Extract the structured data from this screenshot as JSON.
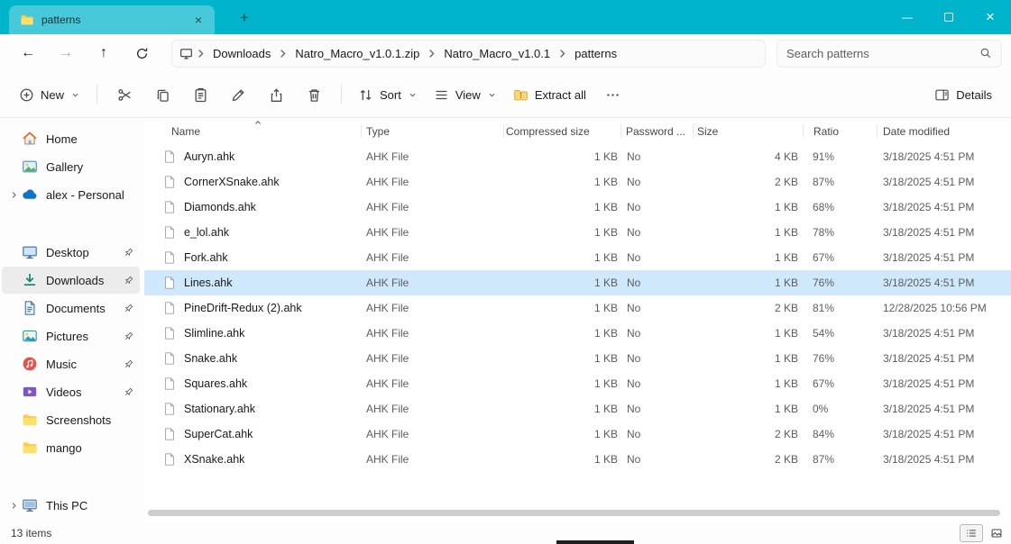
{
  "window": {
    "tab_title": "patterns"
  },
  "glyphs": {
    "back": "←",
    "forward": "→",
    "up": "↑",
    "minimize": "—",
    "close": "×",
    "new_tab": "+",
    "tab_close": "×"
  },
  "navigation": {
    "breadcrumb": [
      "Downloads",
      "Natro_Macro_v1.0.1.zip",
      "Natro_Macro_v1.0.1",
      "patterns"
    ],
    "search_placeholder": "Search patterns"
  },
  "toolbar": {
    "new": "New",
    "sort": "Sort",
    "view": "View",
    "extract_all": "Extract all",
    "details": "Details"
  },
  "sidebar": {
    "items": [
      {
        "label": "Home",
        "icon": "home-icon",
        "chevron": false,
        "pinned": false,
        "selected": false,
        "spacer_before": false
      },
      {
        "label": "Gallery",
        "icon": "gallery-icon",
        "chevron": false,
        "pinned": false,
        "selected": false,
        "spacer_before": false
      },
      {
        "label": "alex - Personal",
        "icon": "onedrive-icon",
        "chevron": true,
        "pinned": false,
        "selected": false,
        "spacer_before": false
      },
      {
        "label": "Desktop",
        "icon": "desktop-icon",
        "chevron": false,
        "pinned": true,
        "selected": false,
        "spacer_before": true
      },
      {
        "label": "Downloads",
        "icon": "downloads-icon",
        "chevron": false,
        "pinned": true,
        "selected": true,
        "spacer_before": false
      },
      {
        "label": "Documents",
        "icon": "documents-icon",
        "chevron": false,
        "pinned": true,
        "selected": false,
        "spacer_before": false
      },
      {
        "label": "Pictures",
        "icon": "pictures-icon",
        "chevron": false,
        "pinned": true,
        "selected": false,
        "spacer_before": false
      },
      {
        "label": "Music",
        "icon": "music-icon",
        "chevron": false,
        "pinned": true,
        "selected": false,
        "spacer_before": false
      },
      {
        "label": "Videos",
        "icon": "videos-icon",
        "chevron": false,
        "pinned": true,
        "selected": false,
        "spacer_before": false
      },
      {
        "label": "Screenshots",
        "icon": "folder-icon",
        "chevron": false,
        "pinned": false,
        "selected": false,
        "spacer_before": false
      },
      {
        "label": "mango",
        "icon": "folder-icon",
        "chevron": false,
        "pinned": false,
        "selected": false,
        "spacer_before": false
      },
      {
        "label": "This PC",
        "icon": "this-pc-icon",
        "chevron": true,
        "pinned": false,
        "selected": false,
        "spacer_before": true
      }
    ]
  },
  "file_list": {
    "sorted_by": "Name",
    "sort_ascending": true,
    "columns": [
      {
        "label": "Name",
        "key": "name"
      },
      {
        "label": "Type",
        "key": "type"
      },
      {
        "label": "Compressed size",
        "key": "compressed"
      },
      {
        "label": "Password ...",
        "key": "password"
      },
      {
        "label": "Size",
        "key": "size"
      },
      {
        "label": "Ratio",
        "key": "ratio"
      },
      {
        "label": "Date modified",
        "key": "modified"
      }
    ],
    "rows": [
      {
        "name": "Auryn.ahk",
        "type": "AHK File",
        "compressed": "1 KB",
        "password": "No",
        "size": "4 KB",
        "ratio": "91%",
        "modified": "3/18/2025 4:51 PM",
        "selected": false
      },
      {
        "name": "CornerXSnake.ahk",
        "type": "AHK File",
        "compressed": "1 KB",
        "password": "No",
        "size": "2 KB",
        "ratio": "87%",
        "modified": "3/18/2025 4:51 PM",
        "selected": false
      },
      {
        "name": "Diamonds.ahk",
        "type": "AHK File",
        "compressed": "1 KB",
        "password": "No",
        "size": "1 KB",
        "ratio": "68%",
        "modified": "3/18/2025 4:51 PM",
        "selected": false
      },
      {
        "name": "e_lol.ahk",
        "type": "AHK File",
        "compressed": "1 KB",
        "password": "No",
        "size": "1 KB",
        "ratio": "78%",
        "modified": "3/18/2025 4:51 PM",
        "selected": false
      },
      {
        "name": "Fork.ahk",
        "type": "AHK File",
        "compressed": "1 KB",
        "password": "No",
        "size": "1 KB",
        "ratio": "67%",
        "modified": "3/18/2025 4:51 PM",
        "selected": false
      },
      {
        "name": "Lines.ahk",
        "type": "AHK File",
        "compressed": "1 KB",
        "password": "No",
        "size": "1 KB",
        "ratio": "76%",
        "modified": "3/18/2025 4:51 PM",
        "selected": true
      },
      {
        "name": "PineDrift-Redux (2).ahk",
        "type": "AHK File",
        "compressed": "1 KB",
        "password": "No",
        "size": "2 KB",
        "ratio": "81%",
        "modified": "12/28/2025 10:56 PM",
        "selected": false
      },
      {
        "name": "Slimline.ahk",
        "type": "AHK File",
        "compressed": "1 KB",
        "password": "No",
        "size": "1 KB",
        "ratio": "54%",
        "modified": "3/18/2025 4:51 PM",
        "selected": false
      },
      {
        "name": "Snake.ahk",
        "type": "AHK File",
        "compressed": "1 KB",
        "password": "No",
        "size": "1 KB",
        "ratio": "76%",
        "modified": "3/18/2025 4:51 PM",
        "selected": false
      },
      {
        "name": "Squares.ahk",
        "type": "AHK File",
        "compressed": "1 KB",
        "password": "No",
        "size": "1 KB",
        "ratio": "67%",
        "modified": "3/18/2025 4:51 PM",
        "selected": false
      },
      {
        "name": "Stationary.ahk",
        "type": "AHK File",
        "compressed": "1 KB",
        "password": "No",
        "size": "1 KB",
        "ratio": "0%",
        "modified": "3/18/2025 4:51 PM",
        "selected": false
      },
      {
        "name": "SuperCat.ahk",
        "type": "AHK File",
        "compressed": "1 KB",
        "password": "No",
        "size": "2 KB",
        "ratio": "84%",
        "modified": "3/18/2025 4:51 PM",
        "selected": false
      },
      {
        "name": "XSnake.ahk",
        "type": "AHK File",
        "compressed": "1 KB",
        "password": "No",
        "size": "2 KB",
        "ratio": "87%",
        "modified": "3/18/2025 4:51 PM",
        "selected": false
      }
    ]
  },
  "status_bar": {
    "items_count": "13 items"
  }
}
